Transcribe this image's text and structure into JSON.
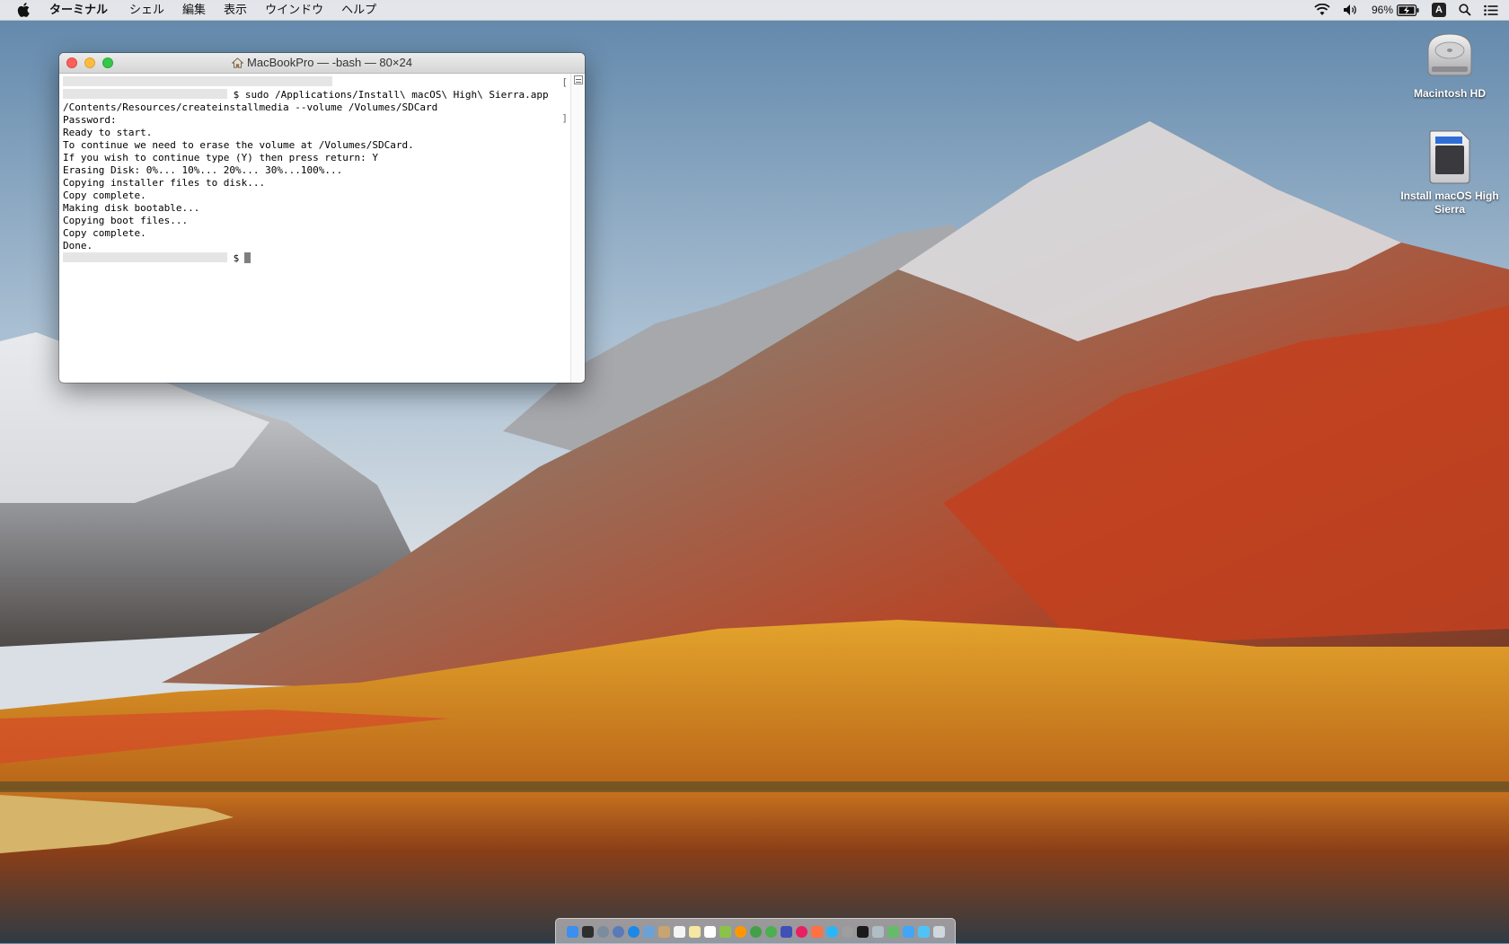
{
  "menubar": {
    "apple_icon": "apple-logo-icon",
    "app_name": "ターミナル",
    "items": [
      "シェル",
      "編集",
      "表示",
      "ウインドウ",
      "ヘルプ"
    ],
    "battery_percent": "96%",
    "input_source": "A",
    "status_icons": [
      "wifi-icon",
      "volume-icon",
      "battery-charging-icon",
      "spotlight-icon",
      "notification-center-icon"
    ]
  },
  "terminal": {
    "title": "MacBookPro — -bash — 80×24",
    "title_icon": "home-icon",
    "lines": [
      {
        "redact_before": true,
        "text": "$ sudo /Applications/Install\\ macOS\\ High\\ Sierra.app"
      },
      {
        "text": "/Contents/Resources/createinstallmedia --volume /Volumes/SDCard"
      },
      {
        "text": "Password:"
      },
      {
        "text": "Ready to start."
      },
      {
        "text": "To continue we need to erase the volume at /Volumes/SDCard."
      },
      {
        "text": "If you wish to continue type (Y) then press return: Y"
      },
      {
        "text": "Erasing Disk: 0%... 10%... 20%... 30%...100%..."
      },
      {
        "text": "Copying installer files to disk..."
      },
      {
        "text": "Copy complete."
      },
      {
        "text": "Making disk bootable..."
      },
      {
        "text": "Copying boot files..."
      },
      {
        "text": "Copy complete."
      },
      {
        "text": "Done."
      },
      {
        "redact_before": true,
        "text": "$",
        "cursor": true
      }
    ]
  },
  "desktop_icons": [
    {
      "label": "Macintosh HD",
      "icon": "hard-drive-icon"
    },
    {
      "label": "Install macOS High Sierra",
      "icon": "sd-card-icon"
    }
  ],
  "colors": {
    "close": "#fc605c",
    "minimize": "#fdbc40",
    "maximize": "#34c84a"
  }
}
